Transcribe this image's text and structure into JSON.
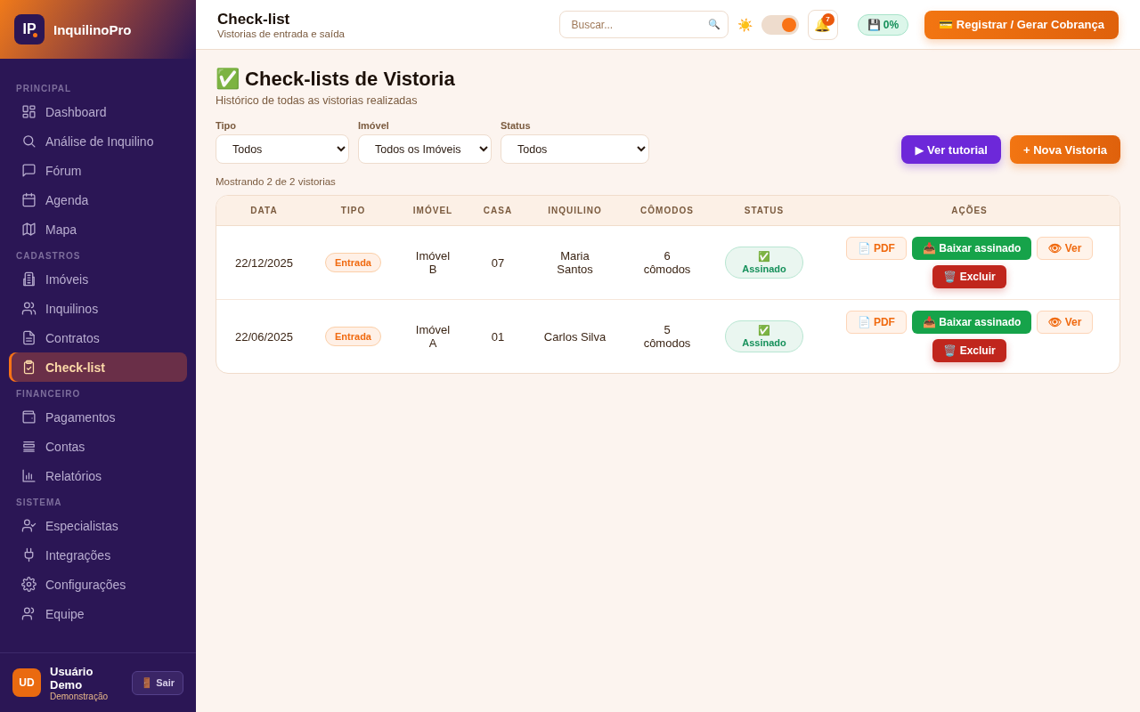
{
  "sidebar": {
    "logo_mark": "IP",
    "brand": "InquilinoPro",
    "sections": [
      {
        "title": "PRINCIPAL",
        "items": [
          {
            "label": "Dashboard",
            "selected": false
          },
          {
            "label": "Análise de Inquilino",
            "selected": false
          },
          {
            "label": "Fórum",
            "selected": false
          },
          {
            "label": "Agenda",
            "selected": false
          },
          {
            "label": "Mapa",
            "selected": false
          }
        ]
      },
      {
        "title": "CADASTROS",
        "items": [
          {
            "label": "Imóveis",
            "selected": false
          },
          {
            "label": "Inquilinos",
            "selected": false
          },
          {
            "label": "Contratos",
            "selected": false
          },
          {
            "label": "Check-list",
            "selected": true
          }
        ]
      },
      {
        "title": "FINANCEIRO",
        "items": [
          {
            "label": "Pagamentos",
            "selected": false
          },
          {
            "label": "Contas",
            "selected": false
          },
          {
            "label": "Relatórios",
            "selected": false
          }
        ]
      },
      {
        "title": "SISTEMA",
        "items": [
          {
            "label": "Especialistas",
            "selected": false
          },
          {
            "label": "Integrações",
            "selected": false
          },
          {
            "label": "Configurações",
            "selected": false
          },
          {
            "label": "Equipe",
            "selected": false
          }
        ]
      }
    ],
    "user": {
      "initials": "UD",
      "name": "Usuário Demo",
      "role": "Demonstração",
      "logout": "🚪 Sair"
    }
  },
  "topbar": {
    "title": "Check-list",
    "subtitle": "Vistorias de entrada e saída",
    "search": {
      "placeholder": "Buscar...",
      "icon": "🔍"
    },
    "theme_icon": "☀️",
    "theme_toggle": {
      "on": true
    },
    "notifications": {
      "icon": "🔔",
      "count": "7"
    },
    "save_badge": "💾 0%",
    "primary_button": "💳 Registrar / Gerar Cobrança"
  },
  "page": {
    "title": "✅ Check-lists de Vistoria",
    "subtitle": "Histórico de todas as vistorias realizadas",
    "filters": [
      {
        "label": "Tipo",
        "value": "Todos"
      },
      {
        "label": "Imóvel",
        "value": "Todos os Imóveis"
      },
      {
        "label": "Status",
        "value": "Todos"
      }
    ],
    "buttons": [
      {
        "label": "▶ Ver tutorial",
        "kind": "tutorial"
      },
      {
        "label": "+ Nova Vistoria",
        "kind": "primary"
      }
    ],
    "count_text": "Mostrando 2 de 2 vistorias",
    "table": {
      "columns": [
        "DATA",
        "TIPO",
        "IMÓVEL",
        "CASA",
        "INQUILINO",
        "CÔMODOS",
        "STATUS",
        "AÇÕES"
      ],
      "rows": [
        {
          "data": "22/12/2025",
          "tipo": "Entrada",
          "imovel": "Imóvel B",
          "casa": "07",
          "inquilino": "Maria Santos",
          "comodos": "6 cômodos",
          "status": "✅ Assinado",
          "actions": [
            {
              "label": "📄 PDF",
              "kind": "pdf"
            },
            {
              "label": "📥 Baixar assinado",
              "kind": "download"
            },
            {
              "label": "👁 Ver",
              "kind": "view"
            },
            {
              "label": "🗑️ Excluir",
              "kind": "delete"
            }
          ]
        },
        {
          "data": "22/06/2025",
          "tipo": "Entrada",
          "imovel": "Imóvel A",
          "casa": "01",
          "inquilino": "Carlos Silva",
          "comodos": "5 cômodos",
          "status": "✅ Assinado",
          "actions": [
            {
              "label": "📄 PDF",
              "kind": "pdf"
            },
            {
              "label": "📥 Baixar assinado",
              "kind": "download"
            },
            {
              "label": "👁 Ver",
              "kind": "view"
            },
            {
              "label": "🗑️ Excluir",
              "kind": "delete"
            }
          ]
        }
      ]
    }
  }
}
